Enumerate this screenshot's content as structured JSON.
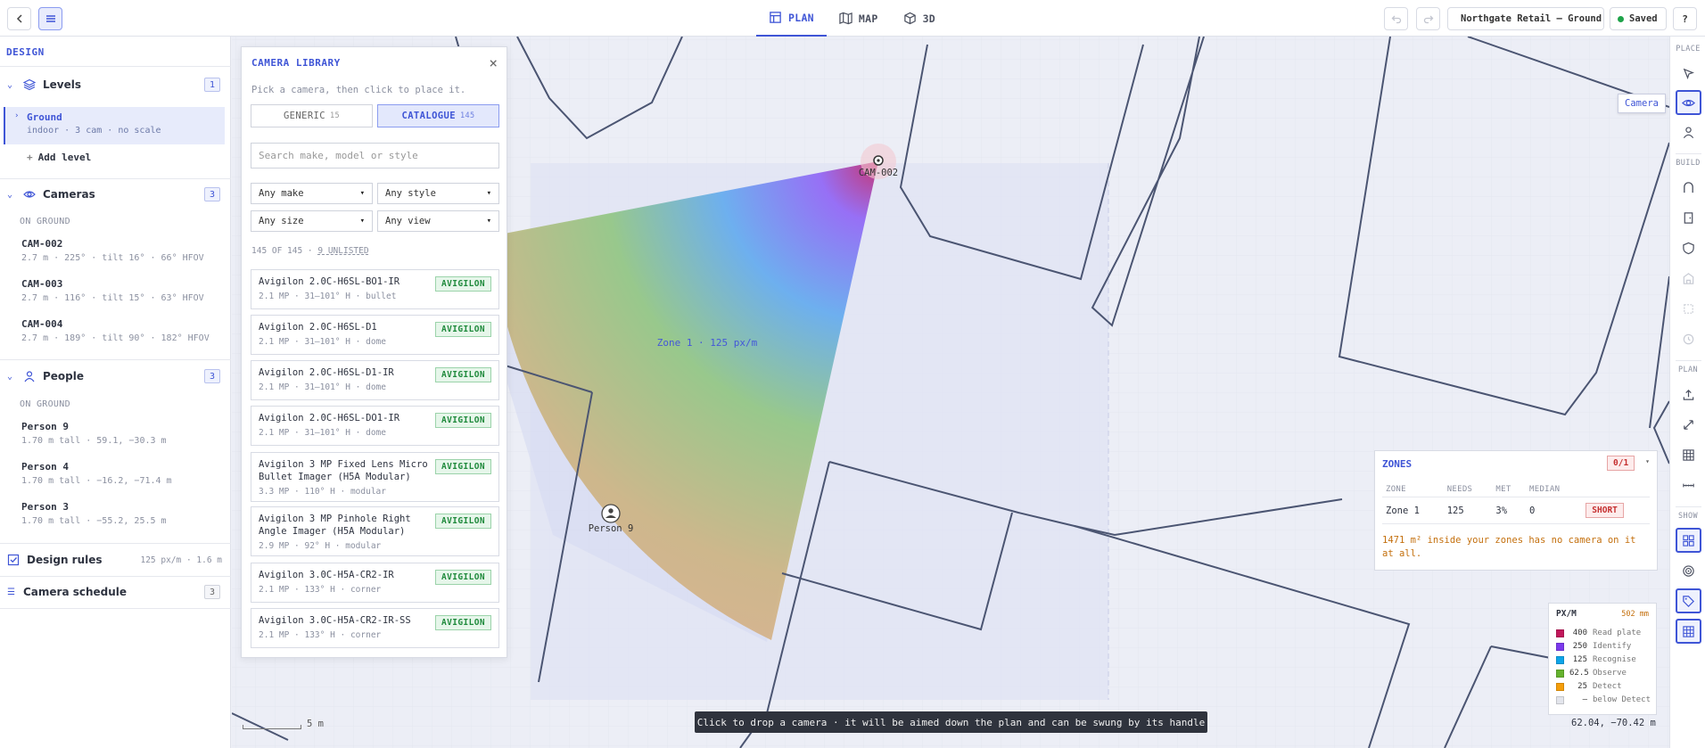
{
  "topbar": {
    "tabs": [
      {
        "label": "PLAN",
        "icon": "plan-icon"
      },
      {
        "label": "MAP",
        "icon": "map-icon"
      },
      {
        "label": "3D",
        "icon": "cube-icon"
      }
    ],
    "project": "Northgate Retail — Ground",
    "status": "Saved",
    "help": "?"
  },
  "sidebar": {
    "title": "DESIGN",
    "levels": {
      "label": "Levels",
      "count": "1",
      "items": [
        {
          "name": "Ground",
          "meta": "indoor · 3 cam · no scale"
        }
      ],
      "add_label": "Add level"
    },
    "cameras": {
      "label": "Cameras",
      "count": "3",
      "group": "ON GROUND",
      "items": [
        {
          "name": "CAM-002",
          "meta": "2.7 m · 225° · tilt 16° · 66° HFOV"
        },
        {
          "name": "CAM-003",
          "meta": "2.7 m · 116° · tilt 15° · 63° HFOV"
        },
        {
          "name": "CAM-004",
          "meta": "2.7 m · 189° · tilt 90° · 182° HFOV"
        }
      ]
    },
    "people": {
      "label": "People",
      "count": "3",
      "group": "ON GROUND",
      "items": [
        {
          "name": "Person 9",
          "meta": "1.70 m tall · 59.1, −30.3 m"
        },
        {
          "name": "Person 4",
          "meta": "1.70 m tall · −16.2, −71.4 m"
        },
        {
          "name": "Person 3",
          "meta": "1.70 m tall · −55.2, 25.5 m"
        }
      ]
    },
    "rules": {
      "label": "Design rules",
      "meta": "125 px/m · 1.6 m"
    },
    "schedule": {
      "label": "Camera schedule",
      "count": "3"
    }
  },
  "library": {
    "title": "CAMERA LIBRARY",
    "hint": "Pick a camera, then click to place it.",
    "segments": [
      {
        "label": "GENERIC",
        "count": "15"
      },
      {
        "label": "CATALOGUE",
        "count": "145"
      }
    ],
    "search_placeholder": "Search make, model or style",
    "filters": [
      "Any make",
      "Any style",
      "Any size",
      "Any view"
    ],
    "list_count": "145 OF 145 ·",
    "unlisted": "9 UNLISTED",
    "items": [
      {
        "name": "Avigilon 2.0C-H6SL-BO1-IR",
        "meta": "2.1 MP · 31–101° H · bullet",
        "brand": "AVIGILON"
      },
      {
        "name": "Avigilon 2.0C-H6SL-D1",
        "meta": "2.1 MP · 31–101° H · dome",
        "brand": "AVIGILON"
      },
      {
        "name": "Avigilon 2.0C-H6SL-D1-IR",
        "meta": "2.1 MP · 31–101° H · dome",
        "brand": "AVIGILON"
      },
      {
        "name": "Avigilon 2.0C-H6SL-DO1-IR",
        "meta": "2.1 MP · 31–101° H · dome",
        "brand": "AVIGILON"
      },
      {
        "name": "Avigilon 3 MP Fixed Lens Micro Bullet Imager (H5A Modular)",
        "meta": "3.3 MP · 110° H · modular",
        "brand": "AVIGILON"
      },
      {
        "name": "Avigilon 3 MP Pinhole Right Angle Imager (H5A Modular)",
        "meta": "2.9 MP · 92° H · modular",
        "brand": "AVIGILON"
      },
      {
        "name": "Avigilon 3.0C-H5A-CR2-IR",
        "meta": "2.1 MP · 133° H · corner",
        "brand": "AVIGILON"
      },
      {
        "name": "Avigilon 3.0C-H5A-CR2-IR-SS",
        "meta": "2.1 MP · 133° H · corner",
        "brand": "AVIGILON"
      }
    ]
  },
  "canvas": {
    "camera_label": "CAM-002",
    "person_label": "Person 9",
    "zone_label": "Zone 1 · 125 px/m",
    "scale_label": "5 m",
    "coords": "62.04, −70.42 m",
    "toast": "Click to drop a camera · it will be aimed down the plan and can be swung by its handle"
  },
  "strip": {
    "groups": [
      "PLACE",
      "BUILD",
      "PLAN",
      "SHOW"
    ],
    "tooltip": "Camera"
  },
  "zones": {
    "title": "ZONES",
    "badge": "0/1",
    "headers": [
      "ZONE",
      "NEEDS",
      "MET",
      "MEDIAN"
    ],
    "rows": [
      {
        "zone": "Zone 1",
        "needs": "125",
        "met": "3%",
        "median": "0",
        "status": "SHORT"
      }
    ],
    "warning": "1471 m² inside your zones has no camera on it at all."
  },
  "legend": {
    "title": "PX/M",
    "range": "502 mm",
    "rows": [
      {
        "value": "400",
        "label": "Read plate",
        "color": "#c2185b"
      },
      {
        "value": "250",
        "label": "Identify",
        "color": "#7c3aed"
      },
      {
        "value": "125",
        "label": "Recognise",
        "color": "#0ea5e9"
      },
      {
        "value": "62.5",
        "label": "Observe",
        "color": "#65b32e"
      },
      {
        "value": "25",
        "label": "Detect",
        "color": "#f59e0b"
      },
      {
        "value": "—",
        "label": "below Detect",
        "color": "#e3e5ec"
      }
    ]
  }
}
